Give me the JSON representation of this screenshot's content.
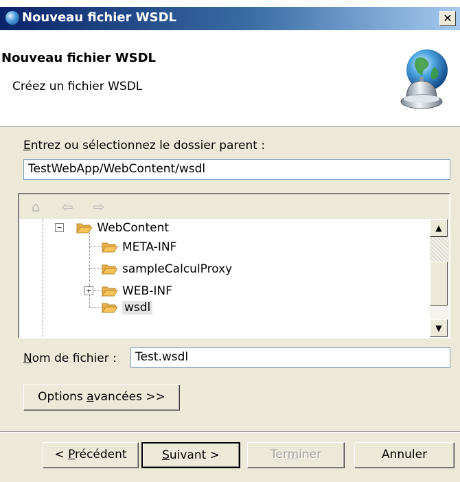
{
  "window": {
    "title": "Nouveau fichier WSDL",
    "close_glyph": "✕"
  },
  "header": {
    "title": "Nouveau fichier WSDL",
    "description": "Créez un fichier WSDL",
    "image_icon": "globe-bell-icon"
  },
  "parent_folder": {
    "label_mnemonic": "E",
    "label_rest": "ntrez ou sélectionnez le dossier parent :",
    "value": "TestWebApp/WebContent/wsdl"
  },
  "tree": {
    "toolbar_icons": [
      "home-icon",
      "back-arrow-icon",
      "forward-arrow-icon"
    ],
    "items": [
      {
        "label": "WebContent",
        "expander": "−"
      },
      {
        "label": "META-INF",
        "expander": ""
      },
      {
        "label": "sampleCalculProxy",
        "expander": ""
      },
      {
        "label": "WEB-INF",
        "expander": "+"
      },
      {
        "label": "wsdl",
        "expander": "",
        "selected": true
      }
    ],
    "scroll_up": "▲",
    "scroll_down": "▼"
  },
  "filename": {
    "label_mnemonic": "N",
    "label_rest": "om de fichier :",
    "value": "Test.wsdl"
  },
  "advanced_button": {
    "pre": "Options ",
    "mnemonic": "a",
    "post": "vancées >>"
  },
  "buttons": {
    "back": {
      "pre": "< ",
      "mnemonic": "P",
      "post": "récédent"
    },
    "next": {
      "pre": "",
      "mnemonic": "S",
      "post": "uivant >"
    },
    "finish": {
      "pre": "Ter",
      "mnemonic": "m",
      "post": "iner"
    },
    "cancel": "Annuler"
  },
  "colors": {
    "titlebar_start": "#0a246a",
    "titlebar_end": "#a6caf0",
    "dialog_bg": "#ece9d8",
    "folder_yellow": "#f6c25a",
    "selection_bg": "#e3e3e3"
  }
}
